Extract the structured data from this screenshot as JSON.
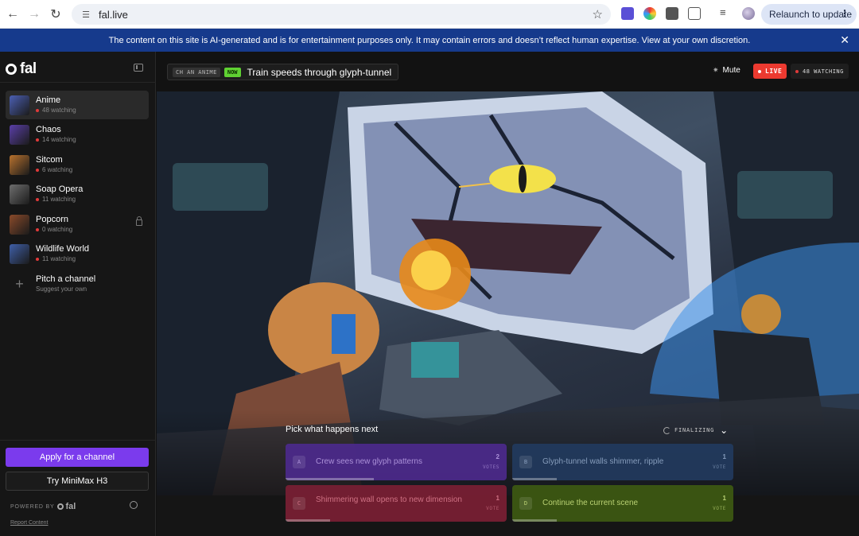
{
  "browser": {
    "url": "fal.live",
    "relaunch_label": "Relaunch to update"
  },
  "banner": {
    "text": "The content on this site is AI-generated and is for entertainment purposes only. It may contain errors and doesn’t reflect human expertise. View at your own discretion."
  },
  "sidebar": {
    "logo_text": "fal",
    "channels": [
      {
        "name": "Anime",
        "sub": "48 watching",
        "active": true,
        "thumb": "#4b5fb3"
      },
      {
        "name": "Chaos",
        "sub": "14 watching",
        "active": false,
        "thumb": "#5a3fa8"
      },
      {
        "name": "Sitcom",
        "sub": "6 watching",
        "active": false,
        "thumb": "#b8722e"
      },
      {
        "name": "Soap Opera",
        "sub": "11 watching",
        "active": false,
        "thumb": "#6e6e6e"
      },
      {
        "name": "Popcorn",
        "sub": "0 watching",
        "active": false,
        "thumb": "#8a4a2a",
        "locked": true
      },
      {
        "name": "Wildlife World",
        "sub": "11 watching",
        "active": false,
        "thumb": "#3f5fa8"
      }
    ],
    "pitch": {
      "name": "Pitch a channel",
      "sub": "Suggest your own"
    },
    "apply_label": "Apply for a channel",
    "try_label": "Try MiniMax H3",
    "powered_label": "POWERED BY",
    "powered_brand": "fal",
    "report_label": "Report Content"
  },
  "player": {
    "channel_tag": "CH AN ANIME",
    "now_tag": "NOW",
    "episode_title": "Train speeds through glyph-tunnel",
    "mute_label": "Mute",
    "live_label": "LIVE",
    "watching_label": "48 WATCHING"
  },
  "poll": {
    "title": "Pick what happens next",
    "status": "FINALIZING",
    "options": [
      {
        "letter": "A",
        "text": "Crew sees new glyph patterns",
        "count": "2",
        "votes_label": "VOTES",
        "share": 0.4
      },
      {
        "letter": "B",
        "text": "Glyph-tunnel walls shimmer, ripple",
        "count": "1",
        "votes_label": "VOTE",
        "share": 0.2
      },
      {
        "letter": "C",
        "text": "Shimmering wall opens to new dimension",
        "count": "1",
        "votes_label": "VOTE",
        "share": 0.2
      },
      {
        "letter": "D",
        "text": "Continue the current scene",
        "count": "1",
        "votes_label": "VOTE",
        "share": 0.2
      }
    ]
  },
  "colors": {
    "accent": "#7b3bed",
    "live": "#ec3a30",
    "now": "#5fd132",
    "banner": "#163a8c",
    "option_a": "#4c2a8c",
    "option_b": "#223a5e",
    "option_c": "#7a1f34",
    "option_d": "#3e5a12"
  }
}
